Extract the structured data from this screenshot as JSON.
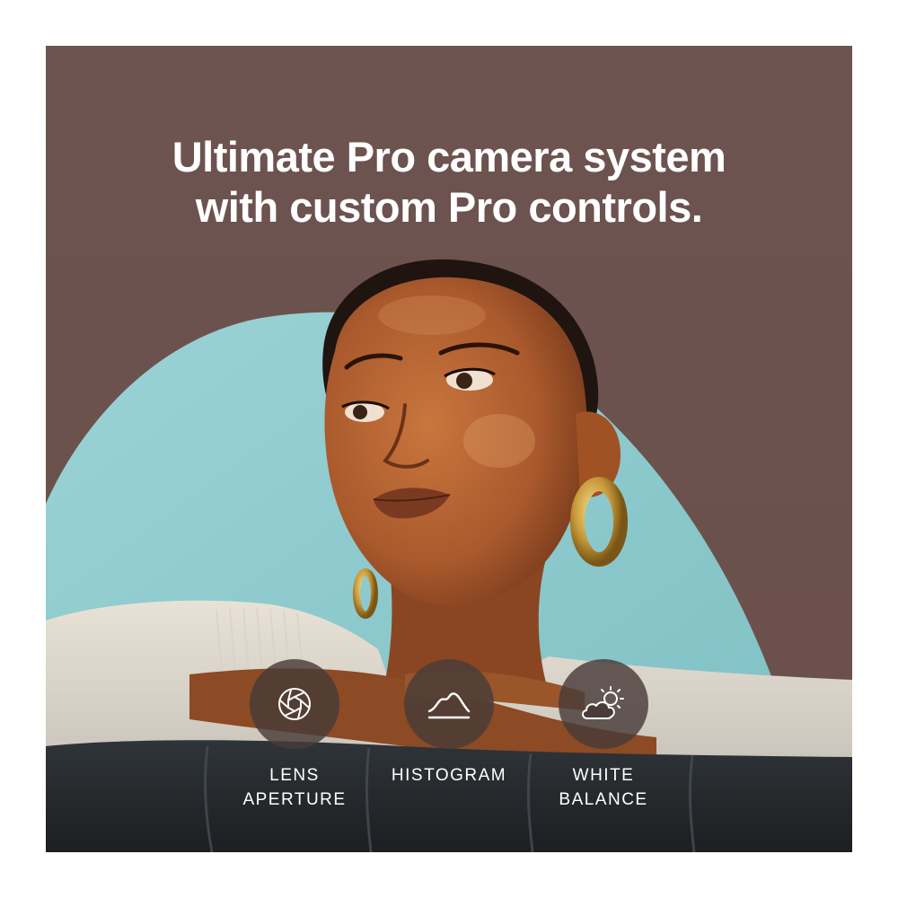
{
  "headline": {
    "line1": "Ultimate Pro camera system",
    "line2": "with custom Pro controls."
  },
  "features": [
    {
      "icon": "aperture-icon",
      "line1": "LENS",
      "line2": "APERTURE"
    },
    {
      "icon": "histogram-icon",
      "line1": "HISTOGRAM",
      "line2": ""
    },
    {
      "icon": "partly-sunny-icon",
      "line1": "WHITE",
      "line2": "BALANCE"
    }
  ],
  "colors": {
    "backdrop": "#6e5450",
    "accent_wall": "#8fc8cc",
    "text": "#ffffff",
    "icon_circle": "#483c38"
  }
}
